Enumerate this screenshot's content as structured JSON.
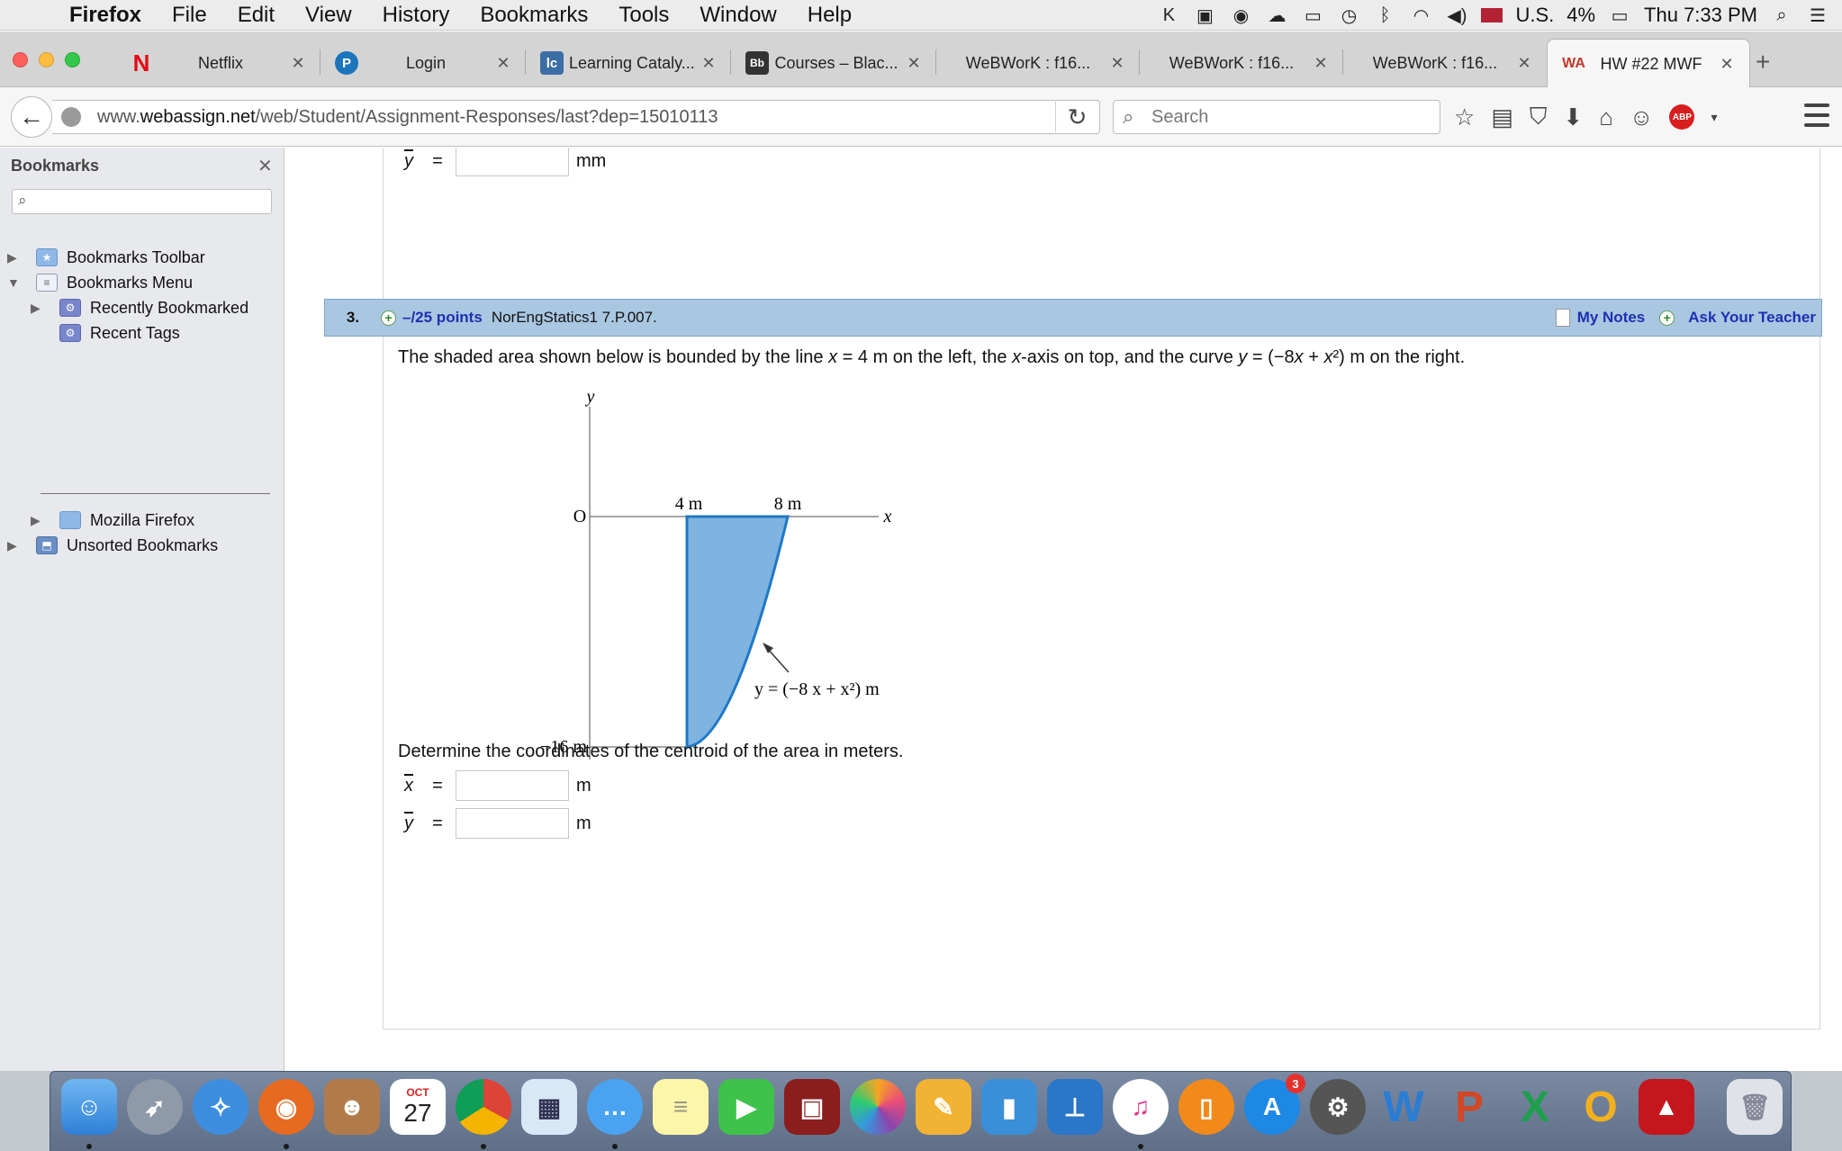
{
  "menubar": {
    "app_name": "Firefox",
    "items": [
      "File",
      "Edit",
      "View",
      "History",
      "Bookmarks",
      "Tools",
      "Window",
      "Help"
    ],
    "input_source": "U.S.",
    "battery": "4%",
    "clock": "Thu 7:33 PM"
  },
  "tabs": [
    {
      "title": "Netflix",
      "fav": "N",
      "fav_color": "#e50914"
    },
    {
      "title": "Login",
      "fav": "P",
      "fav_color": "#1c75bc"
    },
    {
      "title": "Learning Cataly...",
      "fav": "lc",
      "fav_color": "#3a6ea5"
    },
    {
      "title": "Courses – Blac...",
      "fav": "Bb",
      "fav_color": "#333333"
    },
    {
      "title": "WeBWorK : f16...",
      "fav": "",
      "fav_color": ""
    },
    {
      "title": "WeBWorK : f16...",
      "fav": "",
      "fav_color": ""
    },
    {
      "title": "WeBWorK : f16...",
      "fav": "",
      "fav_color": ""
    },
    {
      "title": "HW #22 MWF",
      "fav": "WA",
      "fav_color": "#c0392b"
    }
  ],
  "navbar": {
    "url_prefix": "www.",
    "url_domain": "webassign.net",
    "url_path": "/web/Student/Assignment-Responses/last?dep=15010113",
    "search_placeholder": "Search",
    "abp_label": "ABP"
  },
  "sidebar": {
    "title": "Bookmarks",
    "items": [
      {
        "label": "Bookmarks Toolbar"
      },
      {
        "label": "Bookmarks Menu"
      },
      {
        "label": "Recently Bookmarked"
      },
      {
        "label": "Recent Tags"
      },
      {
        "label": "Mozilla Firefox"
      },
      {
        "label": "Unsorted Bookmarks"
      }
    ]
  },
  "previous_answer": {
    "var": "y",
    "eq": "=",
    "unit": "mm"
  },
  "question": {
    "number": "3.",
    "points": "–/25 points",
    "code": "NorEngStatics1 7.P.007.",
    "my_notes": "My Notes",
    "ask_teacher": "Ask Your Teacher",
    "text_parts": [
      "The shaded area shown below is bounded by the line ",
      "x",
      " = 4 m on the left, the ",
      "x",
      "-axis on top, and the curve ",
      "y",
      " = (−8",
      "x",
      " + ",
      "x",
      "²) m on the right."
    ],
    "prompt": "Determine the coordinates of the centroid of the area in meters.",
    "answers": [
      {
        "var": "x",
        "eq": "=",
        "unit": "m"
      },
      {
        "var": "y",
        "eq": "=",
        "unit": "m"
      }
    ]
  },
  "figure": {
    "y_axis_label": "y",
    "x_axis_label": "x",
    "origin_label": "O",
    "tick_4": "4 m",
    "tick_8": "8 m",
    "tick_neg16": "−16 m",
    "curve_label": "y = (−8 x + x²) m",
    "fill_color": "#7fb3e0",
    "stroke_color": "#1f78c8"
  },
  "dock": {
    "calendar_month": "OCT",
    "calendar_day": "27",
    "appstore_badge": "3"
  }
}
